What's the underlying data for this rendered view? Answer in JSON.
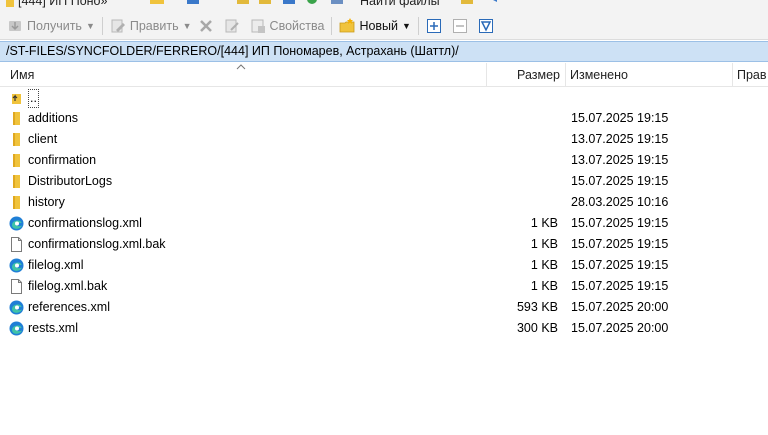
{
  "top_toolbar": {
    "tab_fragment": "[444] ИП Поно»",
    "find_files_label": "Найти файлы"
  },
  "toolbar": {
    "get_label": "Получить",
    "edit_label": "Править",
    "properties_label": "Свойства",
    "new_label": "Новый"
  },
  "path": "/ST-FILES/SYNCFOLDER/FERRERO/[444] ИП Пономарев, Астрахань (Шаттл)/",
  "columns": {
    "name": "Имя",
    "size": "Размер",
    "modified": "Изменено",
    "rights": "Прав"
  },
  "files": [
    {
      "name": "..",
      "type": "parent",
      "size": "",
      "modified": ""
    },
    {
      "name": "additions",
      "type": "folder",
      "size": "",
      "modified": "15.07.2025 19:15"
    },
    {
      "name": "client",
      "type": "folder",
      "size": "",
      "modified": "13.07.2025 19:15"
    },
    {
      "name": "confirmation",
      "type": "folder",
      "size": "",
      "modified": "13.07.2025 19:15"
    },
    {
      "name": "DistributorLogs",
      "type": "folder",
      "size": "",
      "modified": "15.07.2025 19:15"
    },
    {
      "name": "history",
      "type": "folder",
      "size": "",
      "modified": "28.03.2025 10:16"
    },
    {
      "name": "confirmationslog.xml",
      "type": "xml",
      "size": "1 KB",
      "modified": "15.07.2025 19:15"
    },
    {
      "name": "confirmationslog.xml.bak",
      "type": "file",
      "size": "1 KB",
      "modified": "15.07.2025 19:15"
    },
    {
      "name": "filelog.xml",
      "type": "xml",
      "size": "1 KB",
      "modified": "15.07.2025 19:15"
    },
    {
      "name": "filelog.xml.bak",
      "type": "file",
      "size": "1 KB",
      "modified": "15.07.2025 19:15"
    },
    {
      "name": "references.xml",
      "type": "xml",
      "size": "593 KB",
      "modified": "15.07.2025 20:00"
    },
    {
      "name": "rests.xml",
      "type": "xml",
      "size": "300 KB",
      "modified": "15.07.2025 20:00"
    }
  ],
  "colors": {
    "path_bar_bg": "#cde1f5",
    "toolbar_bg": "#f3f3f3",
    "folder_yellow": "#f0c33c"
  }
}
